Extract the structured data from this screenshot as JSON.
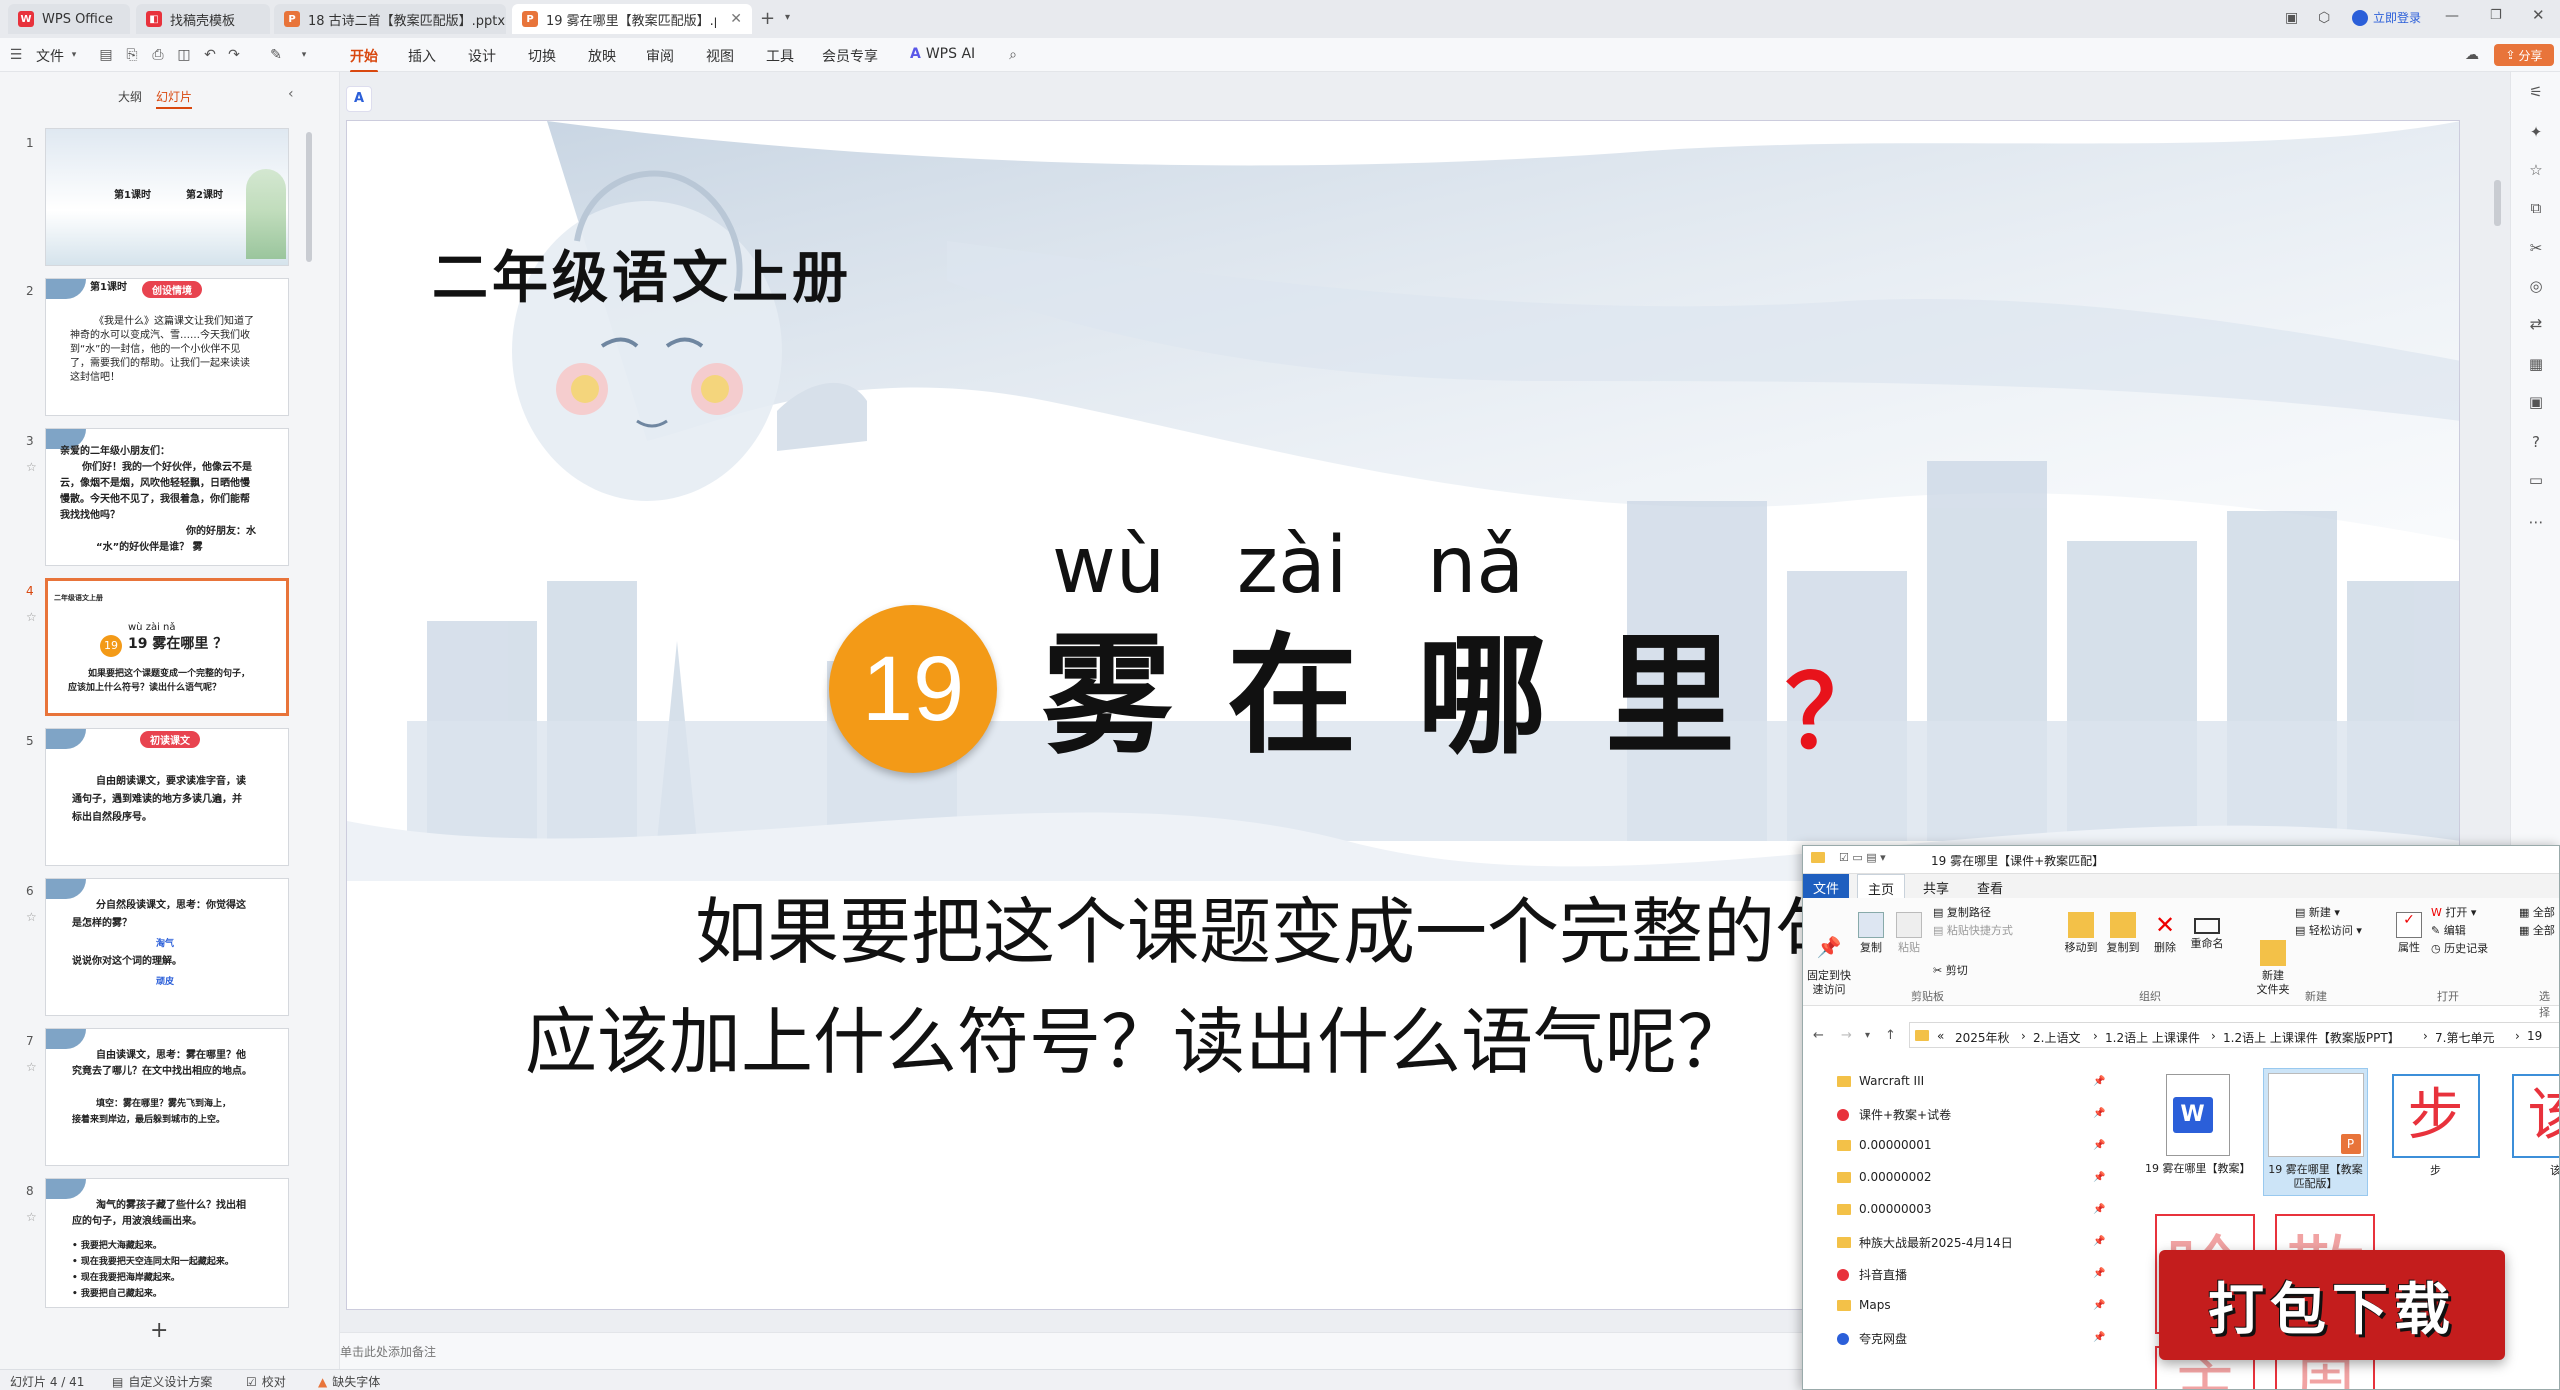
{
  "tabs": [
    {
      "label": "WPS Office",
      "icon_color": "#e8323c"
    },
    {
      "label": "找稿壳模板",
      "icon_color": "#e8323c"
    },
    {
      "label": "18 古诗二首【教案匹配版】.pptx",
      "icon_color": "#e8743a"
    },
    {
      "label": "19 雾在哪里【教案匹配版】.p",
      "icon_color": "#e8743a"
    }
  ],
  "titlebar": {
    "login": "立即登录",
    "share": "分享"
  },
  "menu": {
    "file": "文件",
    "items": [
      "开始",
      "插入",
      "设计",
      "切换",
      "放映",
      "审阅",
      "视图",
      "工具",
      "会员专享"
    ],
    "wps_ai": "WPS AI"
  },
  "left_panel": {
    "tab_outline": "大纲",
    "tab_slides": "幻灯片",
    "add": "+"
  },
  "thumbnails": [
    {
      "num": "1",
      "lines": [
        "第1课时",
        "第2课时"
      ]
    },
    {
      "num": "2",
      "badge": "创设情境",
      "lines": [
        "第1课时",
        "《我是什么》这篇课文让我们知道了",
        "神奇的水可以变成汽、雪……今天我们收",
        "到“水”的一封信，他的一个小伙伴不见",
        "了，需要我们的帮助。让我们一起来读读",
        "这封信吧！"
      ]
    },
    {
      "num": "3",
      "lines": [
        "亲爱的二年级小朋友们：",
        "你们好！我的一个好伙伴，他像云不是",
        "云，像烟不是烟，风吹他轻轻飘，日晒他慢",
        "慢散。今天他不见了，我很着急，你们能帮",
        "我找找他吗？",
        "你的好朋友：水",
        "“水”的好伙伴是谁？ 雾"
      ]
    },
    {
      "num": "4",
      "lines": [
        "二年级语文上册",
        "wù zài nǎ",
        "19 雾在哪里 ？",
        "如果要把这个课题变成一个完整的句子，",
        "应该加上什么符号？读出什么语气呢？"
      ]
    },
    {
      "num": "5",
      "badge": "初读课文",
      "lines": [
        "自由朗读课文，要求读准字音，读",
        "通句子，遇到难读的地方多读几遍，并",
        "标出自然段序号。"
      ]
    },
    {
      "num": "6",
      "lines": [
        "分自然段读课文，思考：你觉得这",
        "是怎样的雾？",
        "淘气",
        "说说你对这个词的理解。",
        "顽皮"
      ]
    },
    {
      "num": "7",
      "lines": [
        "自由读课文，思考：雾在哪里？他",
        "究竟去了哪儿？在文中找出相应的地点。",
        "填空：雾在哪里？雾先飞到海上，",
        "接着来到岸边，最后躲到城市的上空。"
      ]
    },
    {
      "num": "8",
      "lines": [
        "淘气的雾孩子藏了些什么？找出相",
        "应的句子，用波浪线画出来。",
        "• 我要把大海藏起来。",
        "• 现在我要把天空连同太阳一起藏起来。",
        "• 现在我要把海岸藏起来。",
        "• 我要把自己藏起来。"
      ]
    }
  ],
  "slide": {
    "grade_title": "二年级语文上册",
    "pinyin": [
      "wù",
      "zài",
      "nǎ"
    ],
    "number": "19",
    "title_chars": [
      "雾",
      "在",
      "哪",
      "里"
    ],
    "question_mark": "？",
    "body_line1": "如果要把这个课题变成一个完整的句子，",
    "body_line2": "应该加上什么符号？读出什么语气呢？",
    "ai_badge": "A"
  },
  "notes": {
    "placeholder": "单击此处添加备注"
  },
  "status": {
    "slide_count": "幻灯片 4 / 41",
    "custom_design": "自定义设计方案",
    "proofread": "校对",
    "missing_font": "缺失字体"
  },
  "explorer": {
    "title": "19 雾在哪里【课件+教案匹配】",
    "ribbon_tabs": [
      "文件",
      "主页",
      "共享",
      "查看"
    ],
    "ribbon": {
      "pin_quick": "固定到快\n速访问",
      "copy": "复制",
      "paste": "粘贴",
      "copy_path": "复制路径",
      "paste_shortcut": "粘贴快捷方式",
      "cut": "剪切",
      "move_to": "移动到",
      "copy_to": "复制到",
      "delete": "删除",
      "rename": "重命名",
      "new_folder": "新建\n文件夹",
      "new_item": "新建 ▾",
      "easy_access": "轻松访问 ▾",
      "properties": "属性",
      "open": "打开 ▾",
      "edit": "编辑",
      "history": "历史记录",
      "select_all": "全部",
      "select_none": "全部",
      "group_clipboard": "剪贴板",
      "group_organize": "组织",
      "group_new": "新建",
      "group_open": "打开",
      "group_select": "选择"
    },
    "breadcrumb": [
      "«",
      "2025年秋",
      "2.上语文",
      "1.2语上 上课课件",
      "1.2语上 上课课件【教案版PPT】",
      "7.第七单元",
      "19"
    ],
    "nav_items": [
      {
        "label": "Warcraft III",
        "type": "folder"
      },
      {
        "label": "课件+教案+试卷",
        "type": "special"
      },
      {
        "label": "0.00000001",
        "type": "folder"
      },
      {
        "label": "0.00000002",
        "type": "folder"
      },
      {
        "label": "0.00000003",
        "type": "folder"
      },
      {
        "label": "种族大战最新2025-4月14日",
        "type": "folder"
      },
      {
        "label": "抖音直播",
        "type": "special"
      },
      {
        "label": "Maps",
        "type": "folder"
      },
      {
        "label": "夸克网盘",
        "type": "cloud"
      }
    ],
    "files": [
      {
        "label": "19 雾在哪里【教案】",
        "kind": "word"
      },
      {
        "label": "19 雾在哪里【教案匹配版】",
        "kind": "ppt"
      },
      {
        "label": "步",
        "kind": "char"
      },
      {
        "label": "该",
        "kind": "char"
      }
    ],
    "promo_banner": "打包下载",
    "grid_chars": [
      "吟",
      "散",
      "主",
      "周"
    ]
  }
}
